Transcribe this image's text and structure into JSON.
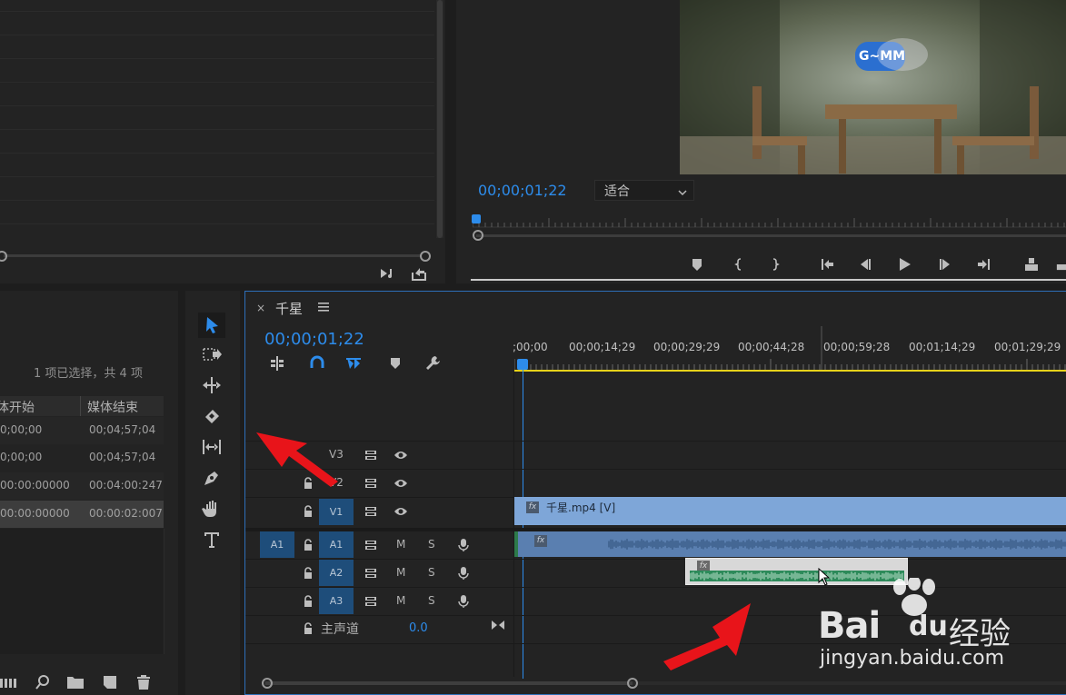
{
  "program_monitor": {
    "timecode": "00;00;01;22",
    "fit_label": "适合",
    "logo_text": "G~MM"
  },
  "project_panel": {
    "selection_info": "1 项已选择，共 4 项",
    "columns": [
      "体开始",
      "媒体结束"
    ],
    "rows": [
      {
        "start": "0;00;00",
        "end": "00;04;57;04",
        "selected": false
      },
      {
        "start": "0;00;00",
        "end": "00;04;57;04",
        "selected": false
      },
      {
        "start": "00:00:00000",
        "end": "00:04:00:247",
        "selected": false
      },
      {
        "start": "00:00:00000",
        "end": "00:00:02:007",
        "selected": true
      }
    ]
  },
  "timeline": {
    "sequence_name": "千星",
    "timecode": "00;00;01;22",
    "ruler_labels": [
      ";00;00",
      "00;00;14;29",
      "00;00;29;29",
      "00;00;44;28",
      "00;00;59;28",
      "00;01;14;29",
      "00;01;29;29"
    ],
    "video_tracks": [
      "V3",
      "V2",
      "V1"
    ],
    "audio_tracks": [
      "A1",
      "A2",
      "A3"
    ],
    "source_patch": "A1",
    "mute_label": "M",
    "solo_label": "S",
    "master_label": "主声道",
    "master_value": "0.0",
    "clip_video_label": "千星.mp4 [V]",
    "fx_label": "fx"
  },
  "watermark": {
    "brand": "Bai",
    "brand2": "du",
    "cn": "经验",
    "url": "jingyan.baidu.com"
  },
  "colors": {
    "accent": "#2d8ceb",
    "clip_video": "#7ea6d8",
    "clip_audio": "#5a7fb0",
    "arrow": "#e8141a",
    "work_area": "#e6d21a"
  }
}
